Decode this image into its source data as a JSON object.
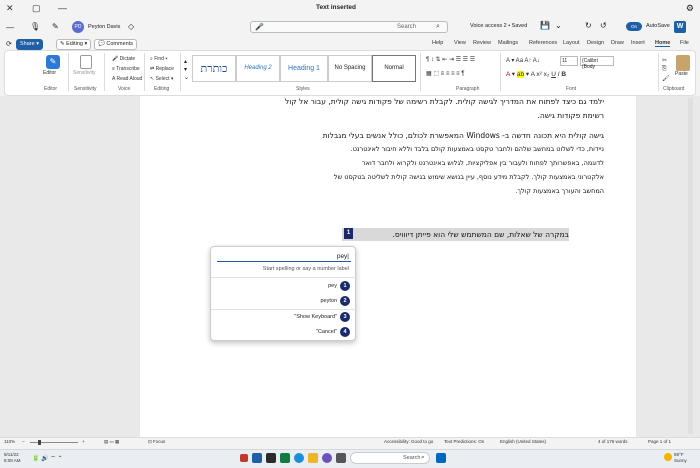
{
  "window": {
    "title": "Text inserted",
    "settings_icon": "gear-icon"
  },
  "quick_access": {
    "autosave_label": "AutoSave",
    "autosave_state": "On",
    "file_name": "Voice access 2 • Saved",
    "search_placeholder": "Search",
    "user_name": "Peyton Davis",
    "user_initials": "PD"
  },
  "ribbon_tabs": [
    "File",
    "Home",
    "Insert",
    "Draw",
    "Design",
    "Layout",
    "References",
    "Mailings",
    "Review",
    "View",
    "Help"
  ],
  "active_tab": "Home",
  "right_toolbar": {
    "share_label": "Share",
    "editing_label": "Editing",
    "comments_label": "Comments"
  },
  "ribbon": {
    "clipboard": {
      "paste_label": "Paste",
      "group_label": "Clipboard"
    },
    "font": {
      "font_name": "(Calibri (Body",
      "font_size": "11",
      "group_label": "Font"
    },
    "paragraph": {
      "group_label": "Paragraph"
    },
    "styles": {
      "group_label": "Styles",
      "items": [
        "Normal",
        "No Spacing",
        "Heading 1",
        "Heading 2",
        "כותרת"
      ]
    },
    "editing": {
      "find_label": "Find",
      "replace_label": "Replace",
      "select_label": "Select",
      "group_label": "Editing"
    },
    "voice": {
      "dictate_label": "Dictate",
      "transcribe_label": "Transcribe",
      "read_aloud_label": "Read Aloud",
      "group_label": "Voice"
    },
    "sensitivity": {
      "label": "Sensitivity",
      "group_label": "Sensitivity"
    },
    "editor": {
      "label": "Editor",
      "group_label": "Editor"
    }
  },
  "document": {
    "paragraphs": [
      "ילמד גם כיצד לפתוח את המדריך לגישה קולית. לקבלת רשימה של פקודות גישה קולית, עבור אל קול",
      "רשימת פקודות גישה.",
      "גישה קולית היא תכונה חדשה ב- Windows המאפשרת לכולם, כולל אנשים בעלי מגבלות",
      "ניידות, כדי לשלוט במחשב שלהם ולחבר טקסט באמצעות קולם בלבד וללא חיבור לאינטרנט.",
      "לדוגמה, באפשרותך לפתוח ולעבור בין אפליקציות, לגלוש באינטרנט ולקרוא ולחבר דואר",
      "אלקטרוני באמצעות קולך. לקבלת מידע נוסף, עיין בנושא שימוש בגישה קולית לשליטה בטקסט של",
      "המחשב והעורך באמצעות קולך."
    ],
    "selected_line": "במקרה של שאלות, שם המשתמש שלי הוא פייתן דיווויס.",
    "marker_number": "1"
  },
  "dictation_popup": {
    "input_value": "pey|",
    "hint": "Start spelling or say a number label",
    "items": [
      {
        "number": "1",
        "label": "pey"
      },
      {
        "number": "2",
        "label": "peyton"
      },
      {
        "number": "3",
        "label": "\"Show Keyboard\""
      },
      {
        "number": "4",
        "label": "\"Cancel\""
      }
    ]
  },
  "status_bar": {
    "page": "Page 1 of 1",
    "words": "4 of 176 words",
    "language": "English (United States)",
    "text_predictions": "Text Predictions: On",
    "accessibility": "Accessibility: Good to go",
    "focus": "Focus",
    "zoom": "110%"
  },
  "taskbar": {
    "search_placeholder": "Search",
    "time": "8:08 AM",
    "date": "9/11/22",
    "weather_temp": "69°F",
    "weather_desc": "Sunny"
  }
}
